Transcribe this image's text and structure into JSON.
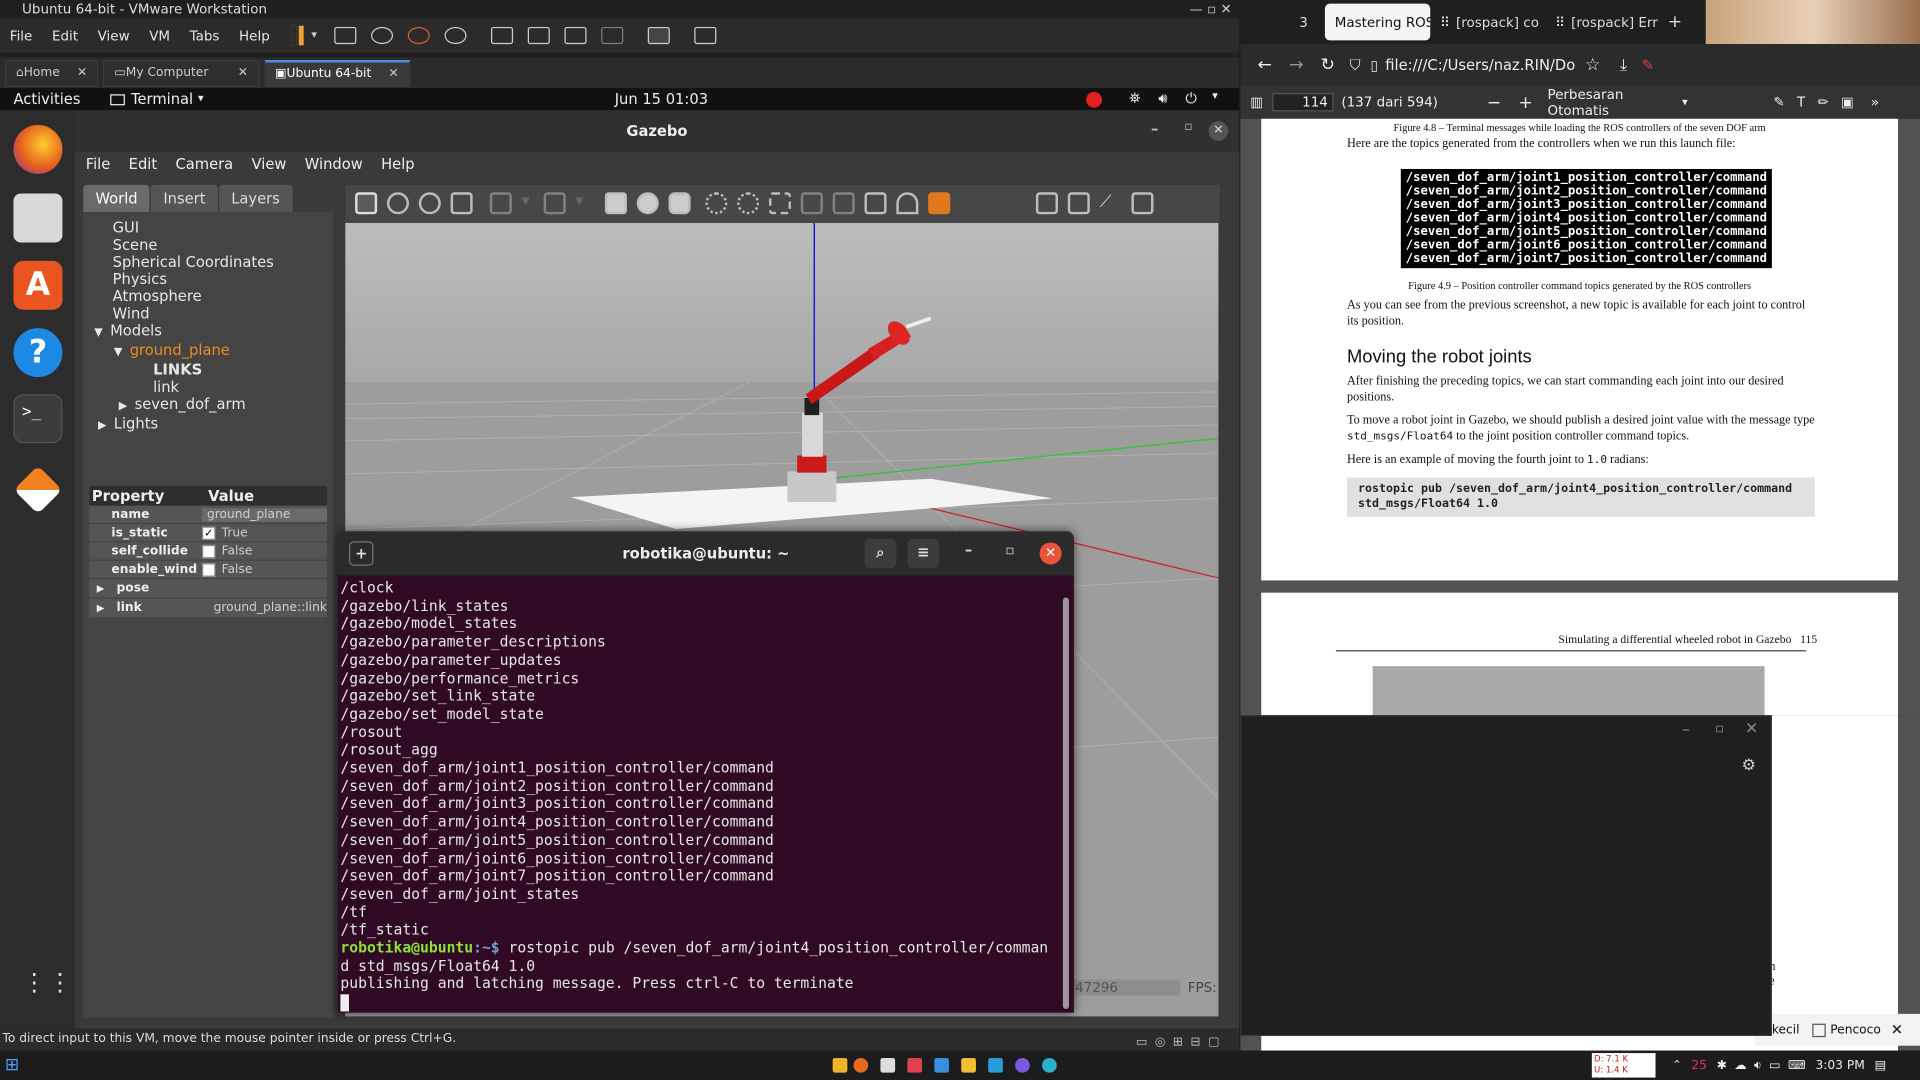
{
  "vmware": {
    "title": "Ubuntu 64-bit - VMware Workstation",
    "menu": [
      "File",
      "Edit",
      "View",
      "VM",
      "Tabs",
      "Help"
    ],
    "tabs": [
      {
        "label": "Home"
      },
      {
        "label": "My Computer"
      },
      {
        "label": "Ubuntu 64-bit"
      }
    ],
    "status": "To direct input to this VM, move the mouse pointer inside or press Ctrl+G."
  },
  "ubuntu": {
    "activities": "Activities",
    "app": "Terminal",
    "clock": "Jun 15  01:03"
  },
  "gazebo": {
    "title": "Gazebo",
    "menu": [
      "File",
      "Edit",
      "Camera",
      "View",
      "Window",
      "Help"
    ],
    "tabs": [
      "World",
      "Insert",
      "Layers"
    ],
    "tree": {
      "gui": "GUI",
      "scene": "Scene",
      "spherical": "Spherical Coordinates",
      "physics": "Physics",
      "atmosphere": "Atmosphere",
      "wind": "Wind",
      "models": "Models",
      "ground_plane": "ground_plane",
      "links": "LINKS",
      "link": "link",
      "arm": "seven_dof_arm",
      "lights": "Lights"
    },
    "props": {
      "header_property": "Property",
      "header_value": "Value",
      "rows": [
        {
          "k": "name",
          "v": "ground_plane"
        },
        {
          "k": "is_static",
          "v": "True"
        },
        {
          "k": "self_collide",
          "v": "False"
        },
        {
          "k": "enable_wind",
          "v": "False"
        },
        {
          "k": "pose",
          "v": ""
        },
        {
          "k": "link",
          "v": "ground_plane::link"
        }
      ]
    },
    "bottom_value": "47296",
    "fps_label": "FPS:"
  },
  "terminal": {
    "title": "robotika@ubuntu: ~",
    "lines": [
      "/clock",
      "/gazebo/link_states",
      "/gazebo/model_states",
      "/gazebo/parameter_descriptions",
      "/gazebo/parameter_updates",
      "/gazebo/performance_metrics",
      "/gazebo/set_link_state",
      "/gazebo/set_model_state",
      "/rosout",
      "/rosout_agg",
      "/seven_dof_arm/joint1_position_controller/command",
      "/seven_dof_arm/joint2_position_controller/command",
      "/seven_dof_arm/joint3_position_controller/command",
      "/seven_dof_arm/joint4_position_controller/command",
      "/seven_dof_arm/joint5_position_controller/command",
      "/seven_dof_arm/joint6_position_controller/command",
      "/seven_dof_arm/joint7_position_controller/command",
      "/seven_dof_arm/joint_states",
      "/tf",
      "/tf_static"
    ],
    "prompt": "robotika@ubuntu",
    "prompt_suffix": ":~$ ",
    "command": "rostopic pub /seven_dof_arm/joint4_position_controller/comman",
    "command2": "d std_msgs/Float64 1.0",
    "output": "publishing and latching message. Press ctrl-C to terminate"
  },
  "browser": {
    "tab_count": "3",
    "tabs": [
      "Mastering ROS",
      "[rospack] co",
      "[rospack] Err"
    ],
    "url": "file:///C:/Users/naz.RIN/Do",
    "page_num": "114",
    "page_of": "(137 dari 594)",
    "zoom": "Perbesaran Otomatis",
    "pdf": {
      "fig48": "Figure 4.8 – Terminal messages while loading the ROS controllers of the seven DOF arm",
      "p1": "Here are the topics generated from the controllers when we run this launch file:",
      "cmds": [
        "/seven_dof_arm/joint1_position_controller/command",
        "/seven_dof_arm/joint2_position_controller/command",
        "/seven_dof_arm/joint3_position_controller/command",
        "/seven_dof_arm/joint4_position_controller/command",
        "/seven_dof_arm/joint5_position_controller/command",
        "/seven_dof_arm/joint6_position_controller/command",
        "/seven_dof_arm/joint7_position_controller/command"
      ],
      "fig49": "Figure 4.9 – Position controller command topics generated by the ROS controllers",
      "p2": "As you can see from the previous screenshot, a new topic is available for each joint to control its position.",
      "h": "Moving the robot joints",
      "p3": "After finishing the preceding topics, we can start commanding each joint into our desired positions.",
      "p4a": "To move a robot joint in Gazebo, we should publish a desired joint value with the message type ",
      "p4code": "std_msgs/Float64",
      "p4b": " to the joint position controller command topics.",
      "p5a": "Here is an example of moving the fourth joint to ",
      "p5code": "1.0",
      "p5b": " radians:",
      "code1": "rostopic pub /seven_dof_arm/joint4_position_controller/command",
      "code2": "std_msgs/Float64 1.0",
      "header2": "Simulating a differential wheeled robot in Gazebo   115"
    },
    "bottom_partial": "kecil",
    "pencocok": "Pencoco",
    "partial_the": "the",
    "partial_n": "n"
  },
  "taskbar": {
    "net_down": "D: 7.1 K",
    "net_up": "U: 1.4 K",
    "time": "3:03 PM",
    "badge": "25"
  }
}
